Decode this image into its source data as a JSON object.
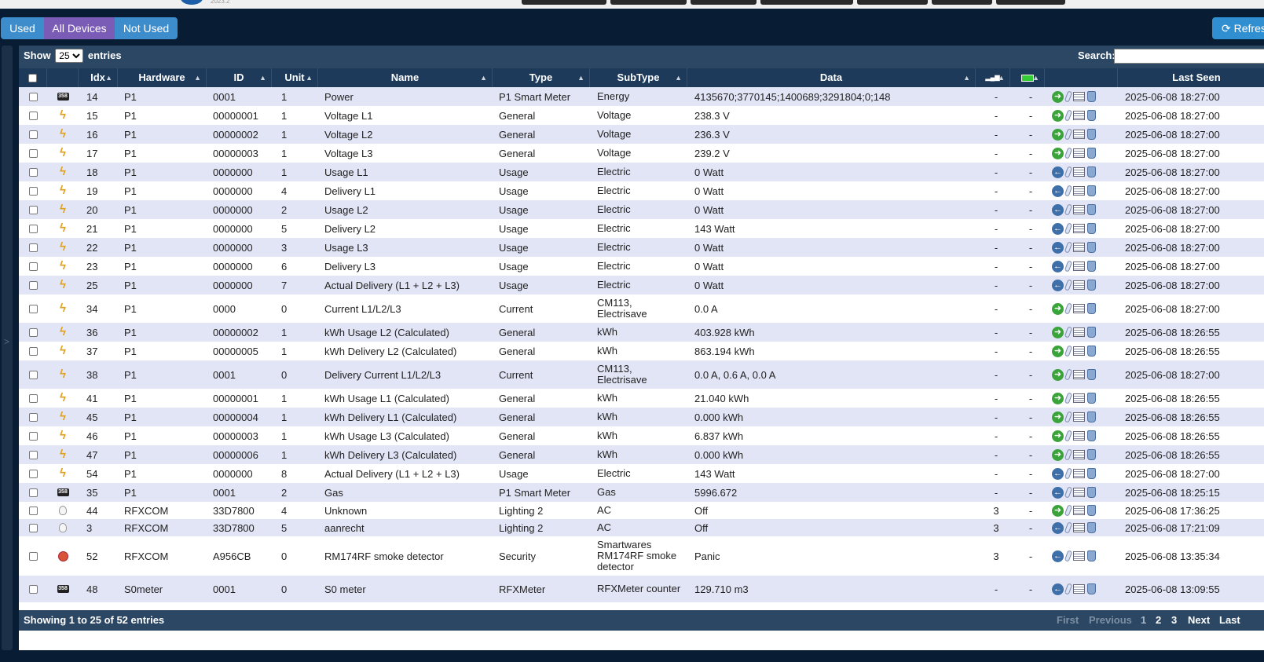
{
  "filters": [
    {
      "label": "Used",
      "color": "#3d8dcd"
    },
    {
      "label": "All Devices",
      "color": "#7a5bb5"
    },
    {
      "label": "Not Used",
      "color": "#3d8dcd"
    }
  ],
  "refresh_label": "Refresh",
  "controls": {
    "show_label": "Show",
    "page_size": "25",
    "entries_label": "entries",
    "search_label": "Search:",
    "search_value": ""
  },
  "columns": [
    "",
    "",
    "Idx",
    "Hardware",
    "ID",
    "Unit",
    "Name",
    "Type",
    "SubType",
    "Data",
    "signal-icon",
    "battery-icon",
    "",
    "Last Seen"
  ],
  "rows": [
    {
      "icon": "meter",
      "idx": "14",
      "hw": "P1",
      "id": "0001",
      "unit": "1",
      "name": "Power",
      "type": "P1 Smart Meter",
      "sub": "Energy",
      "data": "4135670;3770145;1400689;3291804;0;148",
      "sig": "-",
      "bat": "-",
      "fav": "on",
      "seen": "2025-06-08 18:27:00"
    },
    {
      "icon": "bolt",
      "idx": "15",
      "hw": "P1",
      "id": "00000001",
      "unit": "1",
      "name": "Voltage L1",
      "type": "General",
      "sub": "Voltage",
      "data": "238.3 V",
      "sig": "-",
      "bat": "-",
      "fav": "on",
      "seen": "2025-06-08 18:27:00"
    },
    {
      "icon": "bolt",
      "idx": "16",
      "hw": "P1",
      "id": "00000002",
      "unit": "1",
      "name": "Voltage L2",
      "type": "General",
      "sub": "Voltage",
      "data": "236.3 V",
      "sig": "-",
      "bat": "-",
      "fav": "on",
      "seen": "2025-06-08 18:27:00"
    },
    {
      "icon": "bolt",
      "idx": "17",
      "hw": "P1",
      "id": "00000003",
      "unit": "1",
      "name": "Voltage L3",
      "type": "General",
      "sub": "Voltage",
      "data": "239.2 V",
      "sig": "-",
      "bat": "-",
      "fav": "on",
      "seen": "2025-06-08 18:27:00"
    },
    {
      "icon": "bolt",
      "idx": "18",
      "hw": "P1",
      "id": "0000000",
      "unit": "1",
      "name": "Usage L1",
      "type": "Usage",
      "sub": "Electric",
      "data": "0 Watt",
      "sig": "-",
      "bat": "-",
      "fav": "off",
      "seen": "2025-06-08 18:27:00"
    },
    {
      "icon": "bolt",
      "idx": "19",
      "hw": "P1",
      "id": "0000000",
      "unit": "4",
      "name": "Delivery L1",
      "type": "Usage",
      "sub": "Electric",
      "data": "0 Watt",
      "sig": "-",
      "bat": "-",
      "fav": "off",
      "seen": "2025-06-08 18:27:00"
    },
    {
      "icon": "bolt",
      "idx": "20",
      "hw": "P1",
      "id": "0000000",
      "unit": "2",
      "name": "Usage L2",
      "type": "Usage",
      "sub": "Electric",
      "data": "0 Watt",
      "sig": "-",
      "bat": "-",
      "fav": "off",
      "seen": "2025-06-08 18:27:00"
    },
    {
      "icon": "bolt",
      "idx": "21",
      "hw": "P1",
      "id": "0000000",
      "unit": "5",
      "name": "Delivery L2",
      "type": "Usage",
      "sub": "Electric",
      "data": "143 Watt",
      "sig": "-",
      "bat": "-",
      "fav": "off",
      "seen": "2025-06-08 18:27:00"
    },
    {
      "icon": "bolt",
      "idx": "22",
      "hw": "P1",
      "id": "0000000",
      "unit": "3",
      "name": "Usage L3",
      "type": "Usage",
      "sub": "Electric",
      "data": "0 Watt",
      "sig": "-",
      "bat": "-",
      "fav": "off",
      "seen": "2025-06-08 18:27:00"
    },
    {
      "icon": "bolt",
      "idx": "23",
      "hw": "P1",
      "id": "0000000",
      "unit": "6",
      "name": "Delivery L3",
      "type": "Usage",
      "sub": "Electric",
      "data": "0 Watt",
      "sig": "-",
      "bat": "-",
      "fav": "off",
      "seen": "2025-06-08 18:27:00"
    },
    {
      "icon": "bolt",
      "idx": "25",
      "hw": "P1",
      "id": "0000000",
      "unit": "7",
      "name": "Actual Delivery (L1 + L2 + L3)",
      "type": "Usage",
      "sub": "Electric",
      "data": "0 Watt",
      "sig": "-",
      "bat": "-",
      "fav": "off",
      "seen": "2025-06-08 18:27:00"
    },
    {
      "icon": "bolt",
      "idx": "34",
      "hw": "P1",
      "id": "0000",
      "unit": "0",
      "name": "Current L1/L2/L3",
      "type": "Current",
      "sub": "CM113, Electrisave",
      "data": "0.0 A",
      "sig": "-",
      "bat": "-",
      "fav": "on",
      "seen": "2025-06-08 18:27:00"
    },
    {
      "icon": "bolt",
      "idx": "36",
      "hw": "P1",
      "id": "00000002",
      "unit": "1",
      "name": "kWh Usage L2 (Calculated)",
      "type": "General",
      "sub": "kWh",
      "data": "403.928 kWh",
      "sig": "-",
      "bat": "-",
      "fav": "on",
      "seen": "2025-06-08 18:26:55"
    },
    {
      "icon": "bolt",
      "idx": "37",
      "hw": "P1",
      "id": "00000005",
      "unit": "1",
      "name": "kWh Delivery L2 (Calculated)",
      "type": "General",
      "sub": "kWh",
      "data": "863.194 kWh",
      "sig": "-",
      "bat": "-",
      "fav": "on",
      "seen": "2025-06-08 18:26:55"
    },
    {
      "icon": "bolt",
      "idx": "38",
      "hw": "P1",
      "id": "0001",
      "unit": "0",
      "name": "Delivery Current L1/L2/L3",
      "type": "Current",
      "sub": "CM113, Electrisave",
      "data": "0.0 A, 0.6 A, 0.0 A",
      "sig": "-",
      "bat": "-",
      "fav": "on",
      "seen": "2025-06-08 18:27:00"
    },
    {
      "icon": "bolt",
      "idx": "41",
      "hw": "P1",
      "id": "00000001",
      "unit": "1",
      "name": "kWh Usage L1 (Calculated)",
      "type": "General",
      "sub": "kWh",
      "data": "21.040 kWh",
      "sig": "-",
      "bat": "-",
      "fav": "on",
      "seen": "2025-06-08 18:26:55"
    },
    {
      "icon": "bolt",
      "idx": "45",
      "hw": "P1",
      "id": "00000004",
      "unit": "1",
      "name": "kWh Delivery L1 (Calculated)",
      "type": "General",
      "sub": "kWh",
      "data": "0.000 kWh",
      "sig": "-",
      "bat": "-",
      "fav": "on",
      "seen": "2025-06-08 18:26:55"
    },
    {
      "icon": "bolt",
      "idx": "46",
      "hw": "P1",
      "id": "00000003",
      "unit": "1",
      "name": "kWh Usage L3 (Calculated)",
      "type": "General",
      "sub": "kWh",
      "data": "6.837 kWh",
      "sig": "-",
      "bat": "-",
      "fav": "on",
      "seen": "2025-06-08 18:26:55"
    },
    {
      "icon": "bolt",
      "idx": "47",
      "hw": "P1",
      "id": "00000006",
      "unit": "1",
      "name": "kWh Delivery L3 (Calculated)",
      "type": "General",
      "sub": "kWh",
      "data": "0.000 kWh",
      "sig": "-",
      "bat": "-",
      "fav": "on",
      "seen": "2025-06-08 18:26:55"
    },
    {
      "icon": "bolt",
      "idx": "54",
      "hw": "P1",
      "id": "0000000",
      "unit": "8",
      "name": "Actual Delivery (L1 + L2 + L3)",
      "type": "Usage",
      "sub": "Electric",
      "data": "143 Watt",
      "sig": "-",
      "bat": "-",
      "fav": "off",
      "seen": "2025-06-08 18:27:00"
    },
    {
      "icon": "meter",
      "idx": "35",
      "hw": "P1",
      "id": "0001",
      "unit": "2",
      "name": "Gas",
      "type": "P1 Smart Meter",
      "sub": "Gas",
      "data": "5996.672",
      "sig": "-",
      "bat": "-",
      "fav": "off",
      "seen": "2025-06-08 18:25:15"
    },
    {
      "icon": "bulb",
      "idx": "44",
      "hw": "RFXCOM",
      "id": "33D7800",
      "unit": "4",
      "name": "Unknown",
      "type": "Lighting 2",
      "sub": "AC",
      "data": "Off",
      "sig": "3",
      "bat": "-",
      "fav": "on",
      "seen": "2025-06-08 17:36:25"
    },
    {
      "icon": "bulb",
      "idx": "3",
      "hw": "RFXCOM",
      "id": "33D7800",
      "unit": "5",
      "name": "aanrecht",
      "type": "Lighting 2",
      "sub": "AC",
      "data": "Off",
      "sig": "3",
      "bat": "-",
      "fav": "off",
      "seen": "2025-06-08 17:21:09"
    },
    {
      "icon": "smoke",
      "idx": "52",
      "hw": "RFXCOM",
      "id": "A956CB",
      "unit": "0",
      "name": "RM174RF smoke detector",
      "type": "Security",
      "sub": "Smartwares RM174RF smoke detector",
      "data": "Panic",
      "sig": "3",
      "bat": "-",
      "fav": "off",
      "seen": "2025-06-08 13:35:34"
    },
    {
      "icon": "meter",
      "idx": "48",
      "hw": "S0meter",
      "id": "0001",
      "unit": "0",
      "name": "S0 meter",
      "type": "RFXMeter",
      "sub": "RFXMeter counter",
      "data": "129.710 m3",
      "sig": "-",
      "bat": "-",
      "fav": "off",
      "seen": "2025-06-08 13:09:55"
    }
  ],
  "footer": {
    "info": "Showing 1 to 25 of 52 entries",
    "pages": [
      {
        "label": "First",
        "state": "disabled"
      },
      {
        "label": "Previous",
        "state": "disabled"
      },
      {
        "label": "1",
        "state": "current"
      },
      {
        "label": "2",
        "state": "link"
      },
      {
        "label": "3",
        "state": "link"
      },
      {
        "label": "Next",
        "state": "link"
      },
      {
        "label": "Last",
        "state": "link"
      }
    ]
  },
  "colors": {
    "row_alt": "#e2e5f6",
    "header": "#1e3a5a",
    "panel_bar": "#2b4764",
    "page_bg": "#081c33",
    "fav_on": "#3aa33a",
    "fav_off": "#3f6fa8"
  }
}
